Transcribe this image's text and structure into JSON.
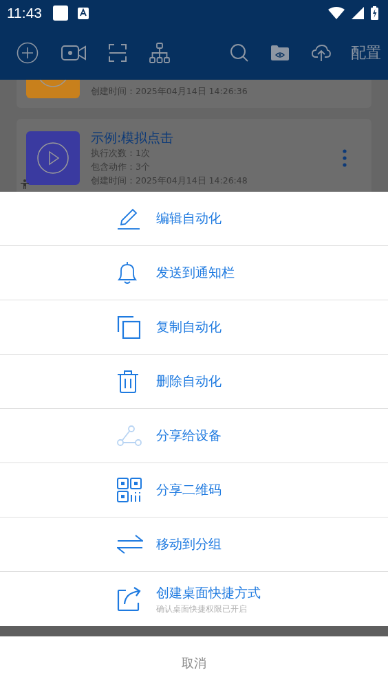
{
  "status_bar": {
    "time": "11:43"
  },
  "toolbar": {
    "config_label": "配置"
  },
  "cards": [
    {
      "lines": [
        "创建时间：2025年04月14日 14:26:36"
      ],
      "color": "#c8801c"
    },
    {
      "title": "示例:模拟点击",
      "lines": [
        "执行次数：1次",
        "包含动作：3个",
        "创建时间：2025年04月14日 14:26:48"
      ],
      "color": "#3a3aa0"
    }
  ],
  "menu": [
    {
      "label": "编辑自动化"
    },
    {
      "label": "发送到通知栏"
    },
    {
      "label": "复制自动化"
    },
    {
      "label": "删除自动化"
    },
    {
      "label": "分享给设备"
    },
    {
      "label": "分享二维码"
    },
    {
      "label": "移动到分组"
    },
    {
      "label": "创建桌面快捷方式",
      "subtitle": "确认桌面快捷权限已开启"
    }
  ],
  "cancel": "取消"
}
